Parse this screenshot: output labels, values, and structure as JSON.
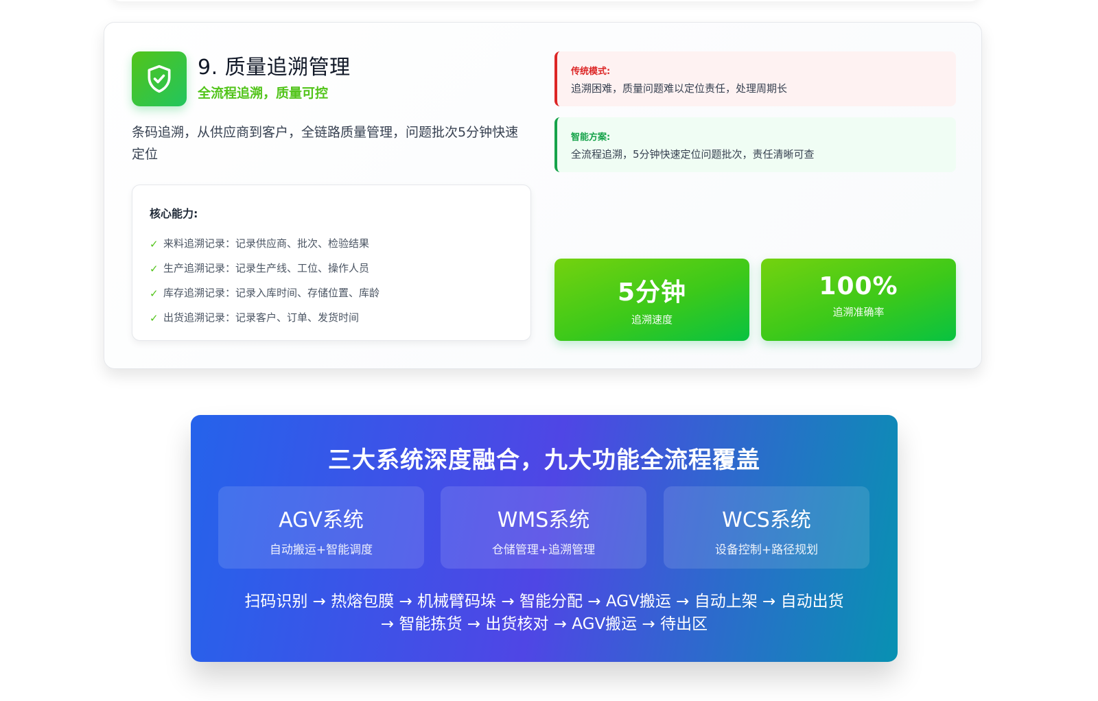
{
  "feature": {
    "title": "9. 质量追溯管理",
    "subtitle": "全流程追溯，质量可控",
    "description": "条码追溯，从供应商到客户，全链路质量管理，问题批次5分钟快速定位",
    "icon": "shield-check-icon",
    "core": {
      "title": "核心能力:",
      "items": [
        "来料追溯记录：记录供应商、批次、检验结果",
        "生产追溯记录：记录生产线、工位、操作人员",
        "库存追溯记录：记录入库时间、存储位置、库龄",
        "出货追溯记录：记录客户、订单、发货时间"
      ]
    },
    "traditional": {
      "label": "传统模式:",
      "text": "追溯困难，质量问题难以定位责任，处理周期长"
    },
    "smart": {
      "label": "智能方案:",
      "text": "全流程追溯，5分钟快速定位问题批次，责任清晰可查"
    },
    "stats": [
      {
        "value": "5分钟",
        "label": "追溯速度"
      },
      {
        "value": "100%",
        "label": "追溯准确率"
      }
    ]
  },
  "banner": {
    "title": "三大系统深度融合，九大功能全流程覆盖",
    "systems": [
      {
        "name": "AGV系统",
        "desc": "自动搬运+智能调度"
      },
      {
        "name": "WMS系统",
        "desc": "仓储管理+追溯管理"
      },
      {
        "name": "WCS系统",
        "desc": "设备控制+路径规划"
      }
    ],
    "flow_line1": "扫码识别 → 热熔包膜 → 机械臂码垛 → 智能分配 → AGV搬运 → 自动上架 → 自动出货",
    "flow_line2": "→ 智能拣货 → 出货核对 → AGV搬运 → 待出区"
  },
  "colors": {
    "accent_green": "#52c41a",
    "traditional_red": "#dc2626",
    "smart_green": "#16a34a",
    "banner_start": "#2563eb",
    "banner_mid": "#4f46e5",
    "banner_end": "#0891b2"
  }
}
